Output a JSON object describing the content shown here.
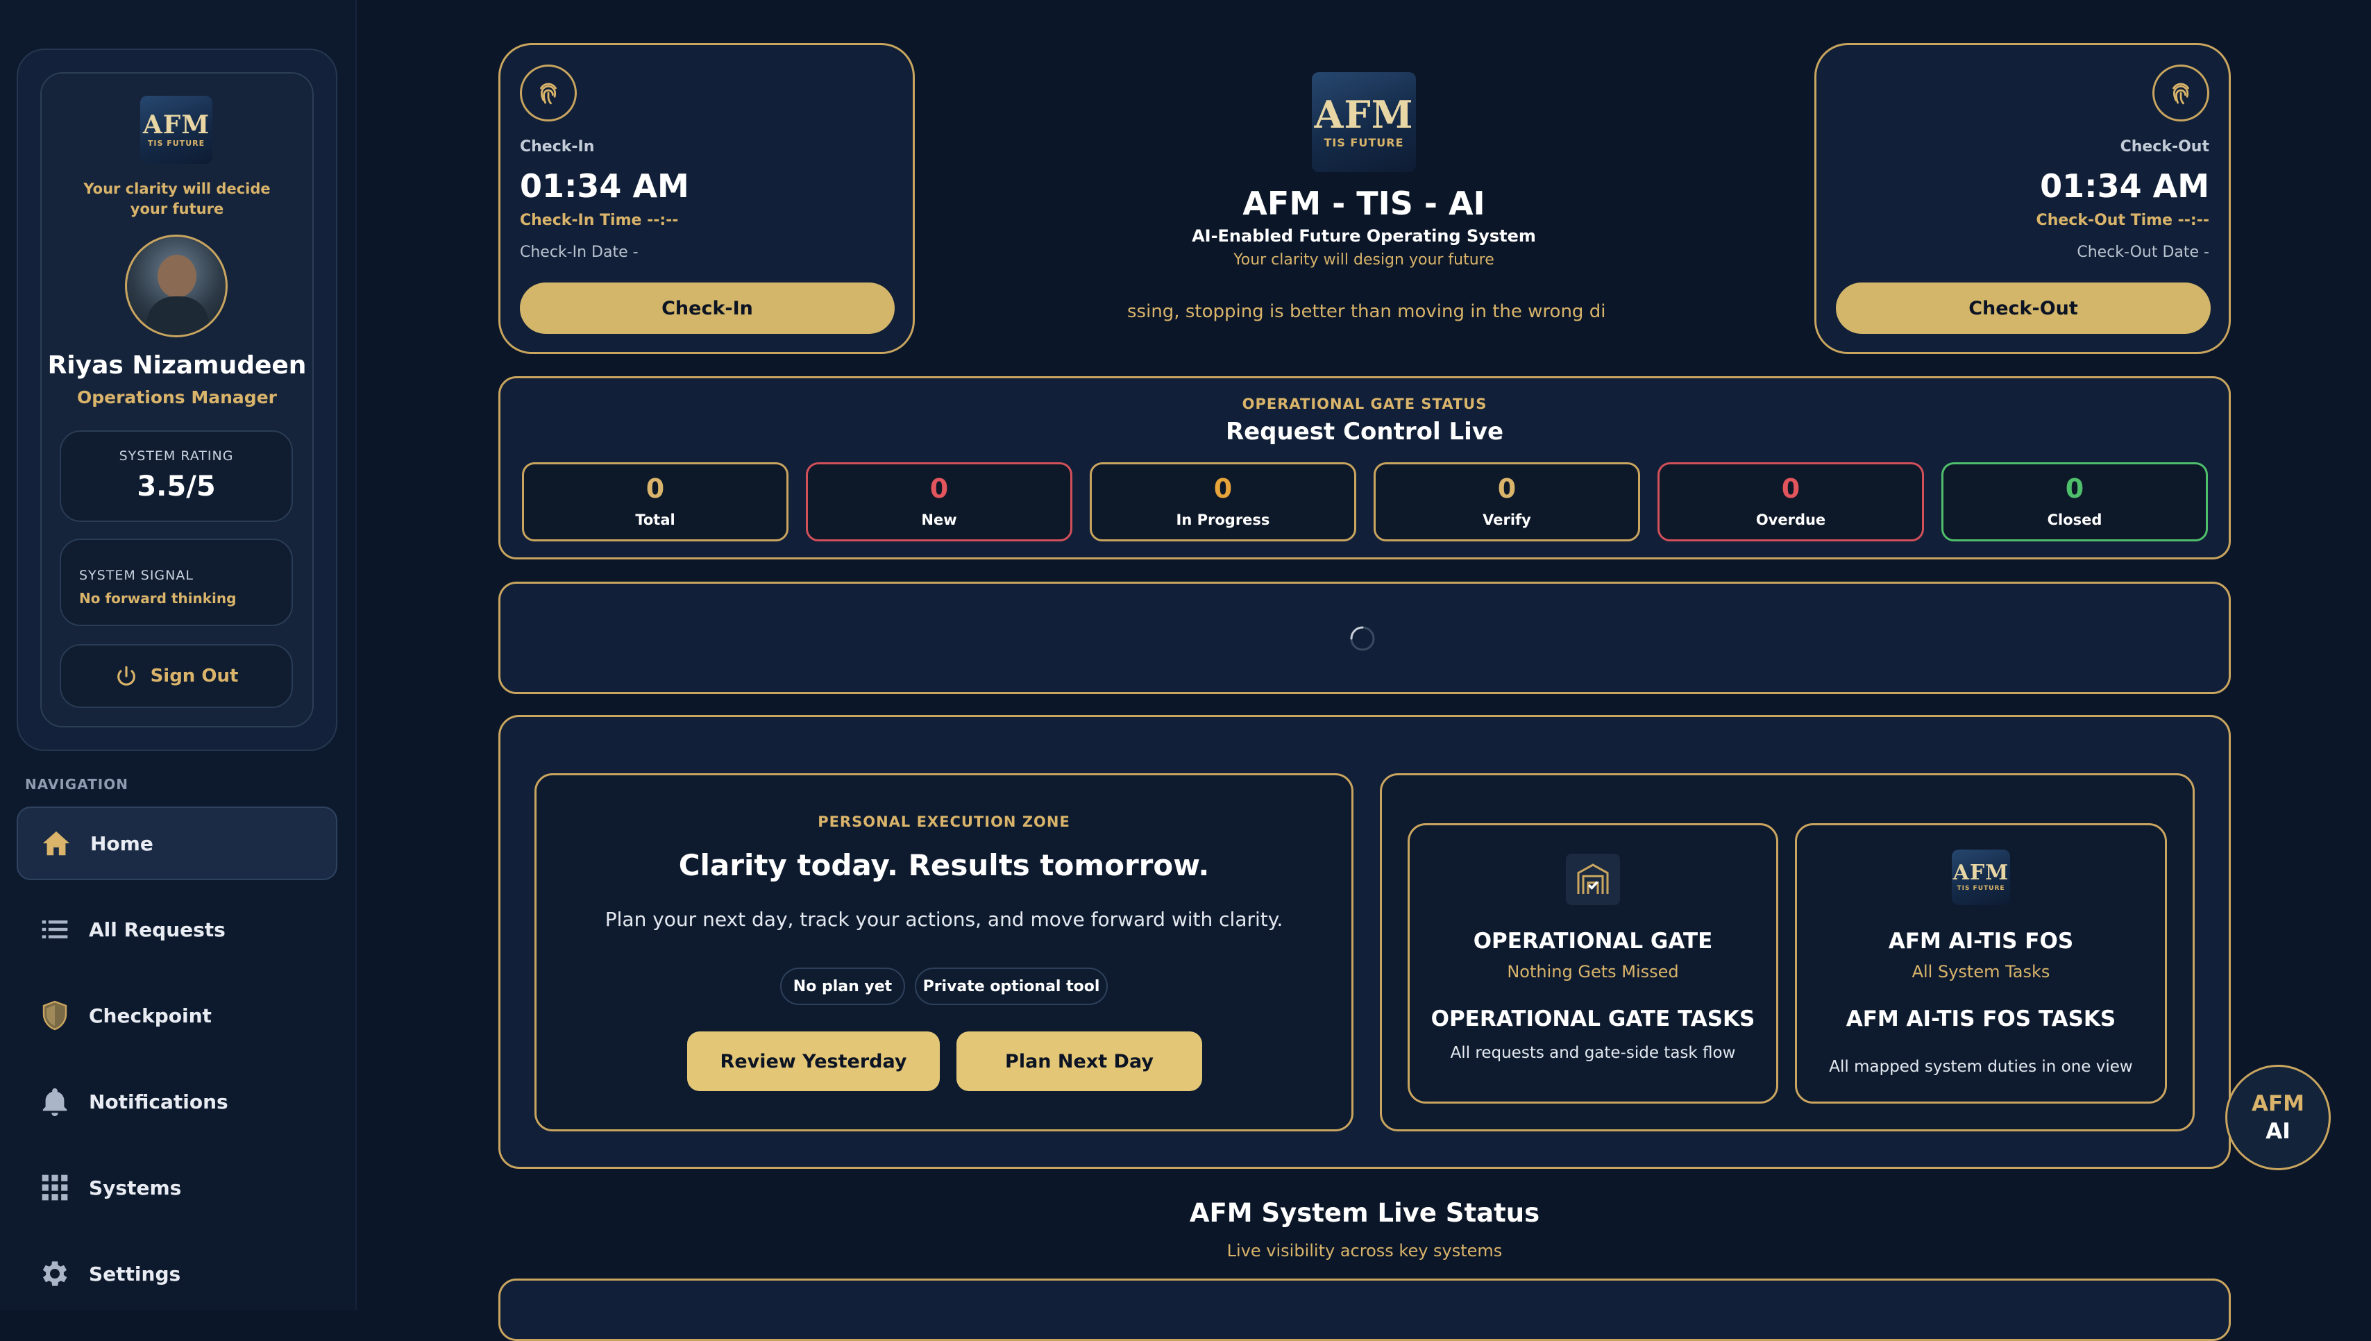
{
  "colors": {
    "background": "#0b1628",
    "gold": "#d9b46a",
    "red": "#e2555d",
    "green": "#4fbf6b"
  },
  "sidebar": {
    "logo": {
      "main": "AFM",
      "sub": "TIS FUTURE"
    },
    "tagline": "Your clarity will decide your future",
    "user_name": "Riyas Nizamudeen",
    "role": "Operations Manager",
    "rating_label": "SYSTEM RATING",
    "rating_value": "3.5/5",
    "signal_label": "SYSTEM SIGNAL",
    "signal_value": "No forward thinking",
    "sign_out": "Sign Out",
    "nav_heading": "NAVIGATION",
    "nav": [
      {
        "label": "Home",
        "icon": "home-icon"
      },
      {
        "label": "All Requests",
        "icon": "list-icon"
      },
      {
        "label": "Checkpoint",
        "icon": "shield-icon"
      },
      {
        "label": "Notifications",
        "icon": "bell-icon"
      },
      {
        "label": "Systems",
        "icon": "grid-icon"
      },
      {
        "label": "Settings",
        "icon": "gear-icon"
      }
    ]
  },
  "checkin": {
    "label": "Check-In",
    "time": "01:34 AM",
    "time_line": "Check-In Time --:--",
    "date_line": "Check-In Date -",
    "button": "Check-In"
  },
  "checkout": {
    "label": "Check-Out",
    "time": "01:34 AM",
    "time_line": "Check-Out Time --:--",
    "date_line": "Check-Out Date -",
    "button": "Check-Out"
  },
  "brand": {
    "logo": {
      "main": "AFM",
      "sub": "TIS FUTURE"
    },
    "title": "AFM - TIS - AI",
    "subtitle": "AI-Enabled Future Operating System",
    "tagline": "Your clarity will design your future",
    "marquee": "ssing, stopping is better than moving in the wrong direc"
  },
  "gate_status": {
    "eyebrow": "OPERATIONAL GATE STATUS",
    "title": "Request Control Live",
    "stats": [
      {
        "value": "0",
        "label": "Total"
      },
      {
        "value": "0",
        "label": "New"
      },
      {
        "value": "0",
        "label": "In Progress"
      },
      {
        "value": "0",
        "label": "Verify"
      },
      {
        "value": "0",
        "label": "Overdue"
      },
      {
        "value": "0",
        "label": "Closed"
      }
    ]
  },
  "execution": {
    "eyebrow": "PERSONAL EXECUTION ZONE",
    "title": "Clarity today. Results tomorrow.",
    "description": "Plan your next day, track your actions, and move forward with clarity.",
    "chips": [
      "No plan yet",
      "Private optional tool"
    ],
    "buttons": [
      "Review Yesterday",
      "Plan Next Day"
    ]
  },
  "op_gate": {
    "title": "OPERATIONAL GATE",
    "subtitle": "Nothing Gets Missed",
    "tasks_title": "OPERATIONAL GATE TASKS",
    "tasks_desc": "All requests and gate-side task flow"
  },
  "fos": {
    "logo": {
      "main": "AFM",
      "sub": "TIS FUTURE"
    },
    "title": "AFM AI-TIS FOS",
    "subtitle": "All System Tasks",
    "tasks_title": "AFM AI-TIS FOS TASKS",
    "tasks_desc": "All mapped system duties in one view"
  },
  "live_status": {
    "title": "AFM System Live Status",
    "subtitle": "Live visibility across key systems"
  },
  "ai_fab": {
    "line1": "AFM",
    "line2": "AI"
  }
}
